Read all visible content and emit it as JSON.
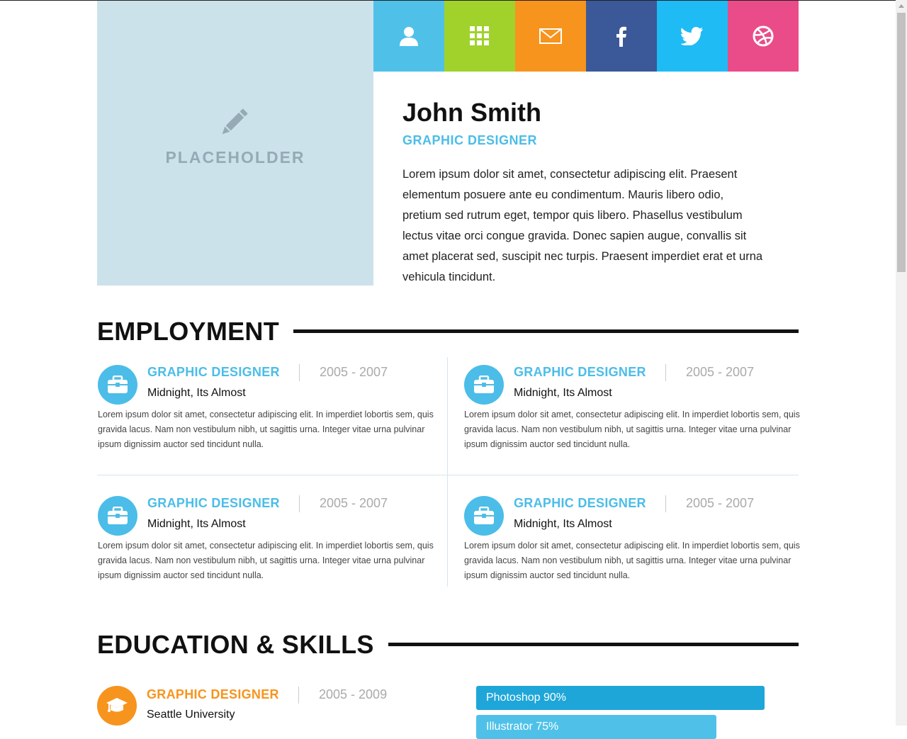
{
  "social": [
    {
      "icon": "user-icon",
      "color": "#4fc1e9"
    },
    {
      "icon": "grid-icon",
      "color": "#a0d22b"
    },
    {
      "icon": "envelope-icon",
      "color": "#f7941d"
    },
    {
      "icon": "facebook-icon",
      "color": "#3b5998"
    },
    {
      "icon": "twitter-icon",
      "color": "#1fbbf5"
    },
    {
      "icon": "dribbble-icon",
      "color": "#ea4c89"
    }
  ],
  "profile": {
    "placeholder": "PLACEHOLDER",
    "name": "John Smith",
    "role": "GRAPHIC DESIGNER",
    "intro": "Lorem ipsum dolor sit amet, consectetur adipiscing elit. Praesent elementum posuere ante eu condimentum. Mauris libero odio, pretium sed rutrum eget, tempor quis libero. Phasellus vestibulum lectus vitae orci congue gravida. Donec sapien augue, convallis sit amet placerat sed, suscipit nec turpis. Praesent imperdiet erat et urna vehicula tincidunt."
  },
  "employment": {
    "heading": "EMPLOYMENT",
    "jobs": [
      {
        "title": "GRAPHIC DESIGNER",
        "years": "2005 - 2007",
        "company": "Midnight, Its Almost",
        "desc": "Lorem ipsum dolor sit amet, consectetur adipiscing elit. In imperdiet lobortis sem, quis gravida lacus. Nam non vestibulum nibh, ut sagittis urna. Integer vitae urna pulvinar ipsum dignissim auctor sed tincidunt nulla."
      },
      {
        "title": "GRAPHIC DESIGNER",
        "years": "2005 - 2007",
        "company": "Midnight, Its Almost",
        "desc": "Lorem ipsum dolor sit amet, consectetur adipiscing elit. In imperdiet lobortis sem, quis gravida lacus. Nam non vestibulum nibh, ut sagittis urna. Integer vitae urna pulvinar ipsum dignissim auctor sed tincidunt nulla."
      },
      {
        "title": "GRAPHIC DESIGNER",
        "years": "2005 - 2007",
        "company": "Midnight, Its Almost",
        "desc": "Lorem ipsum dolor sit amet, consectetur adipiscing elit. In imperdiet lobortis sem, quis gravida lacus. Nam non vestibulum nibh, ut sagittis urna. Integer vitae urna pulvinar ipsum dignissim auctor sed tincidunt nulla."
      },
      {
        "title": "GRAPHIC DESIGNER",
        "years": "2005 - 2007",
        "company": "Midnight, Its Almost",
        "desc": "Lorem ipsum dolor sit amet, consectetur adipiscing elit. In imperdiet lobortis sem, quis gravida lacus. Nam non vestibulum nibh, ut sagittis urna. Integer vitae urna pulvinar ipsum dignissim auctor sed tincidunt nulla."
      }
    ]
  },
  "education": {
    "heading": "EDUCATION & SKILLS",
    "title": "GRAPHIC DESIGNER",
    "years": "2005 - 2009",
    "school": "Seattle University"
  },
  "skills": [
    {
      "label": "Photoshop  90%",
      "level": 0.9,
      "color": "#1fa6d8"
    },
    {
      "label": "Illustrator  75%",
      "level": 0.75,
      "color": "#4fc1e9"
    }
  ]
}
